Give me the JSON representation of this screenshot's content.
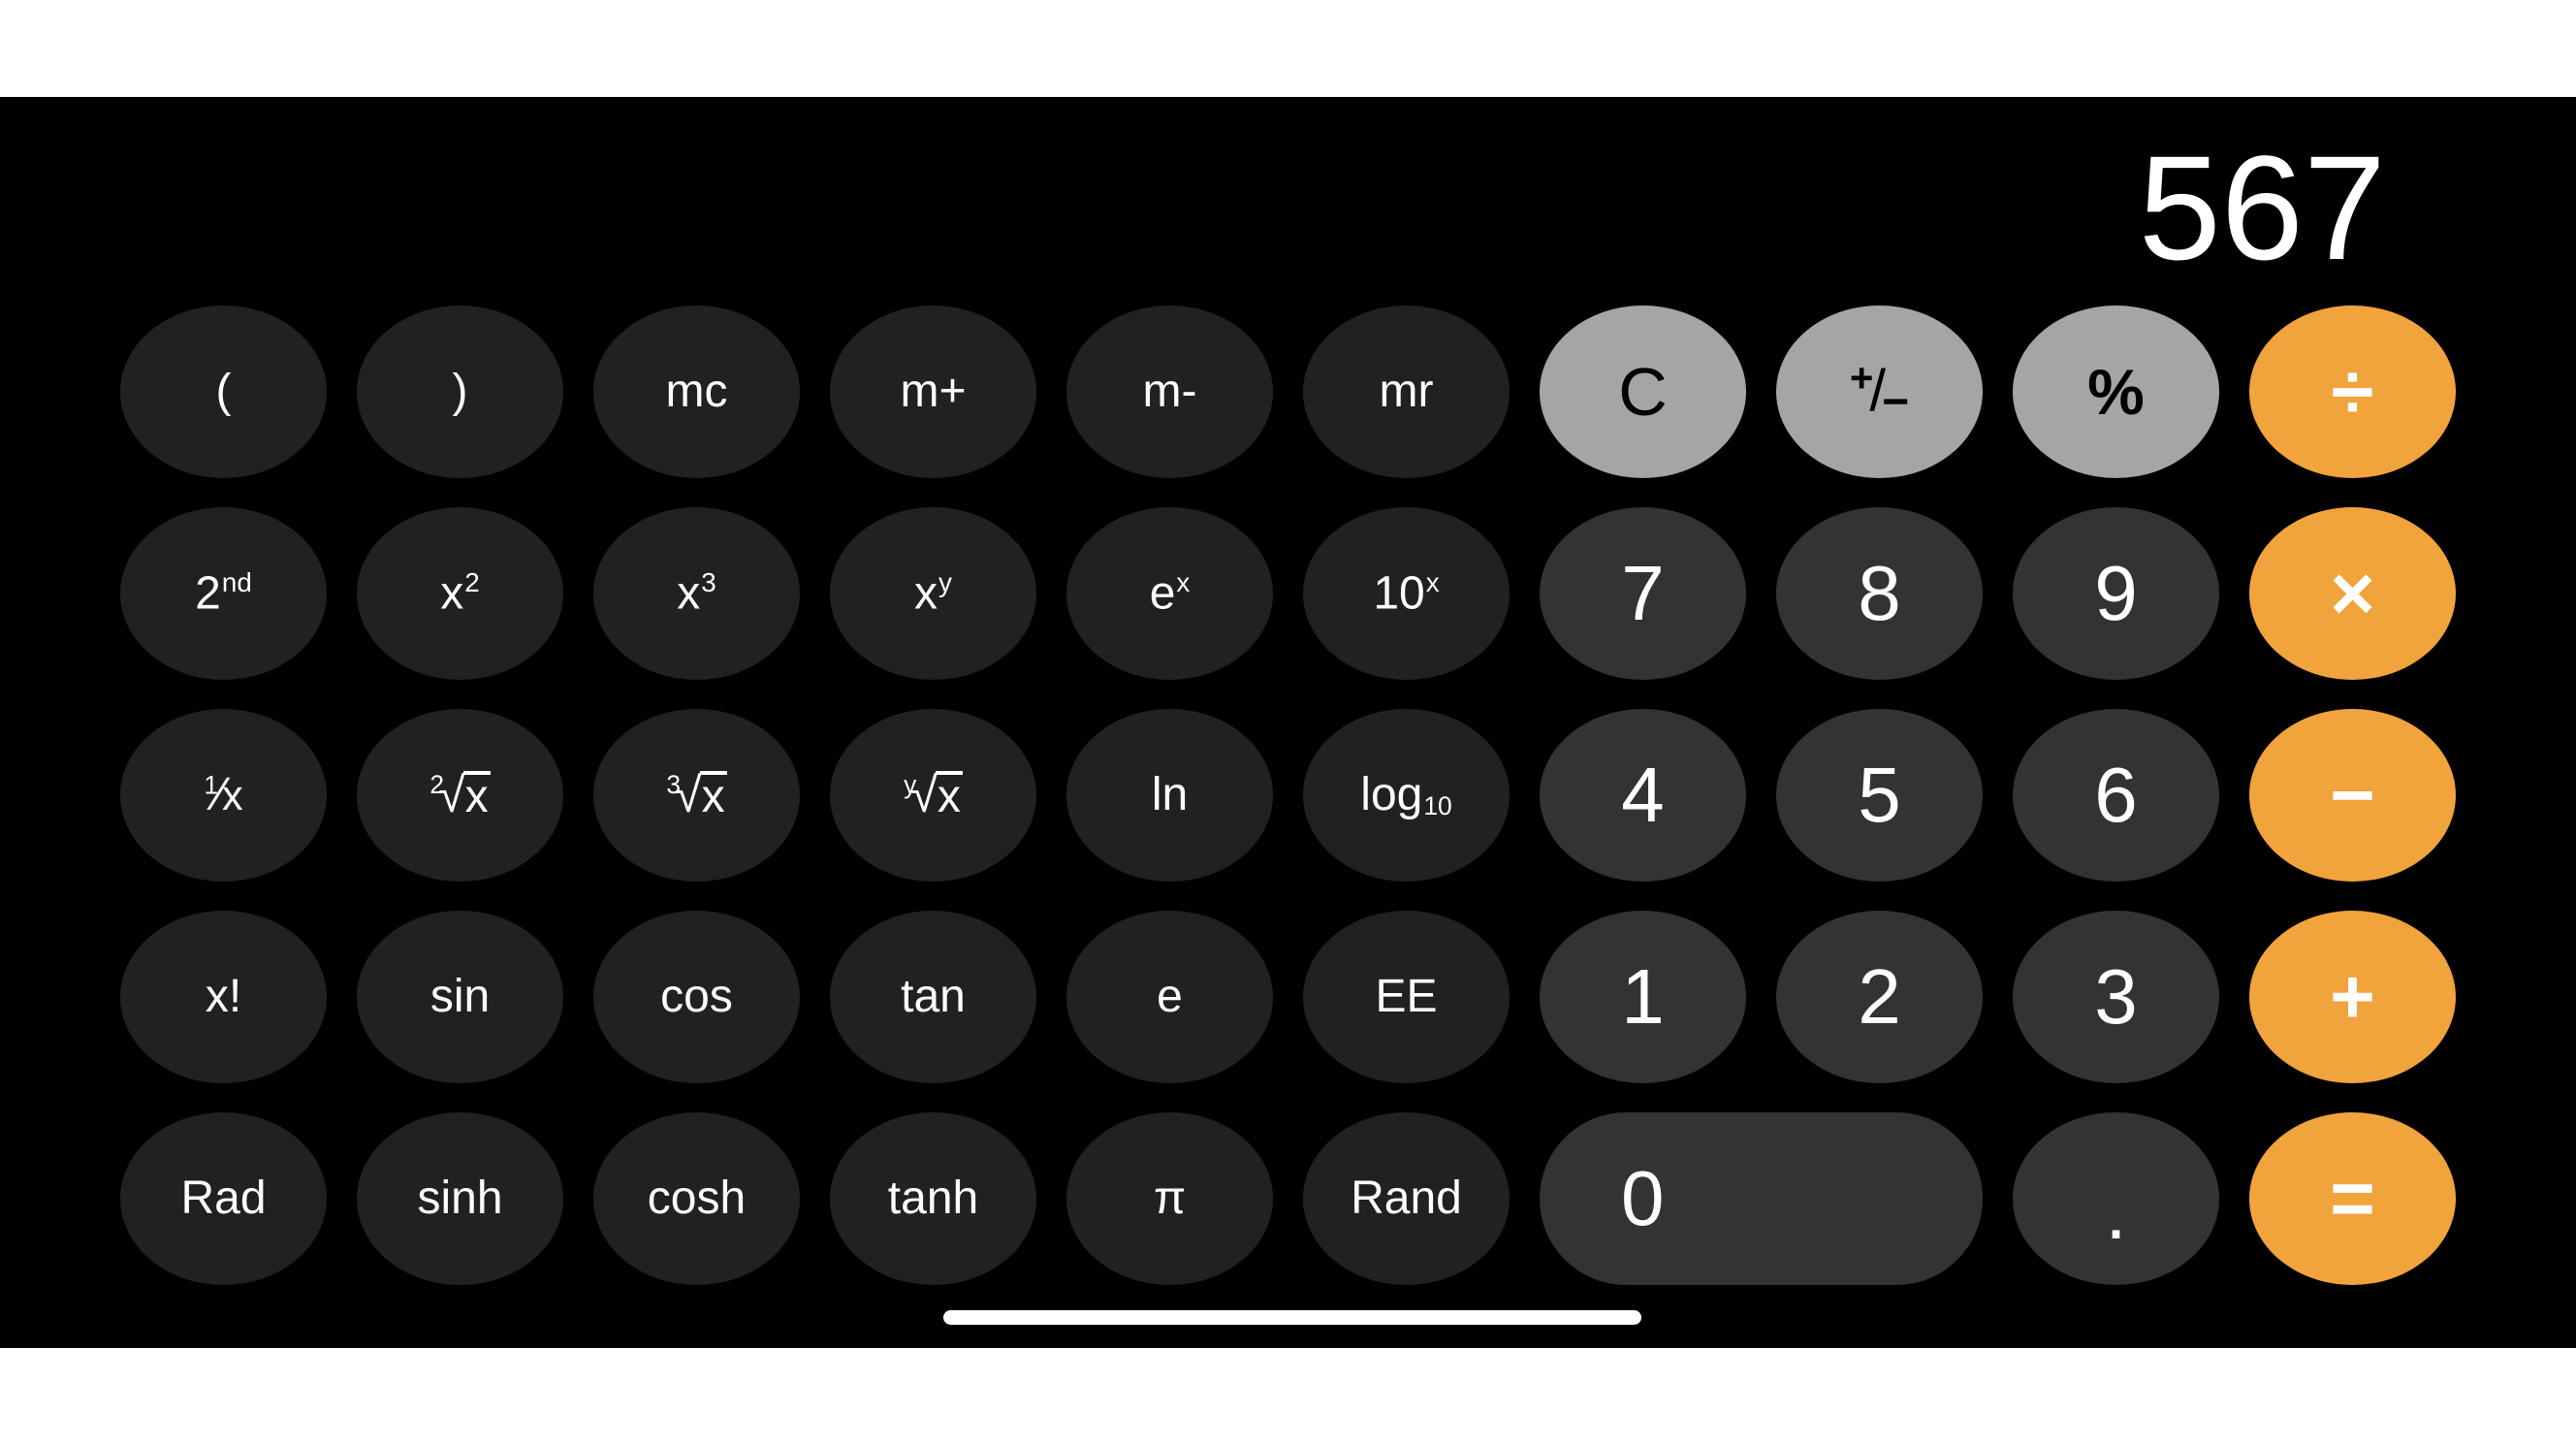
{
  "app": "Calculator (scientific, landscape)",
  "display": {
    "value": "567"
  },
  "colors": {
    "background": "#000000",
    "function_key": "#212121",
    "digit_key": "#333333",
    "utility_key": "#a5a5a5",
    "operator_key": "#f1a33c",
    "text_light": "#ffffff",
    "text_dark": "#000000"
  },
  "keys": {
    "open_paren": "(",
    "close_paren": ")",
    "mc": "mc",
    "m_plus": "m+",
    "m_minus": "m-",
    "mr": "mr",
    "clear": "C",
    "sign": {
      "plus": "+",
      "slash": "/",
      "minus": "−"
    },
    "percent": "%",
    "divide": "÷",
    "second": {
      "base": "2",
      "sup": "nd"
    },
    "x_squared": {
      "base": "x",
      "sup": "2"
    },
    "x_cubed": {
      "base": "x",
      "sup": "3"
    },
    "x_pow_y": {
      "base": "x",
      "sup": "y"
    },
    "e_pow_x": {
      "base": "e",
      "sup": "x"
    },
    "ten_pow_x": {
      "base": "10",
      "sup": "x"
    },
    "seven": "7",
    "eight": "8",
    "nine": "9",
    "multiply": "×",
    "reciprocal": {
      "num": "1",
      "slash": "⁄",
      "den": "x"
    },
    "sqrt": {
      "index": "2",
      "radical": "√",
      "radicand": "x"
    },
    "cbrt": {
      "index": "3",
      "radical": "√",
      "radicand": "x"
    },
    "yroot": {
      "index": "y",
      "radical": "√",
      "radicand": "x"
    },
    "ln": "ln",
    "log10": {
      "base": "log",
      "sub": "10"
    },
    "four": "4",
    "five": "5",
    "six": "6",
    "minus": "−",
    "factorial": "x!",
    "sin": "sin",
    "cos": "cos",
    "tan": "tan",
    "e": "e",
    "ee": "EE",
    "one": "1",
    "two": "2",
    "three": "3",
    "plus": "+",
    "rad": "Rad",
    "sinh": "sinh",
    "cosh": "cosh",
    "tanh": "tanh",
    "pi": "π",
    "rand": "Rand",
    "zero": "0",
    "decimal": ".",
    "equals": "="
  }
}
